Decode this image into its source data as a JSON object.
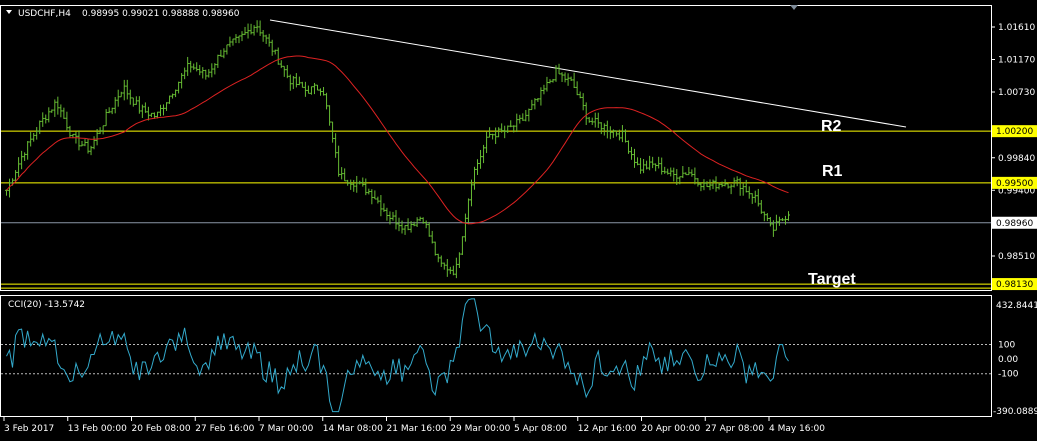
{
  "header": {
    "symbol": "USDCHF,H4",
    "ohlc": "0.98995 0.99021 0.98888 0.98960"
  },
  "indicator": {
    "name": "CCI(20) -13.5742",
    "axis_top_label": "432.8441",
    "axis_bottom_label": "-390.0889",
    "levels": [
      "100",
      "0.00",
      "-100"
    ]
  },
  "annotations": {
    "r2": "R2",
    "r1": "R1",
    "target": "Target"
  },
  "price_axis": {
    "ticks": [
      "1.01610",
      "1.01170",
      "1.00730",
      "0.99840",
      "0.99400",
      "0.98510"
    ],
    "highlighted": [
      "1.00200",
      "0.99500",
      "0.98130"
    ],
    "current": "0.98960"
  },
  "time_axis": {
    "labels": [
      "3 Feb 2017",
      "13 Feb 00:00",
      "20 Feb 08:00",
      "27 Feb 16:00",
      "7 Mar 00:00",
      "14 Mar 08:00",
      "21 Mar 16:00",
      "29 Mar 00:00",
      "5 Apr 08:00",
      "12 Apr 16:00",
      "20 Apr 00:00",
      "27 Apr 08:00",
      "4 May 16:00"
    ]
  },
  "colors": {
    "background": "#000000",
    "bars": "#66bb33",
    "ma": "#dd2222",
    "level": "#ffff00",
    "trendline": "#ffffff",
    "cci": "#33aacc",
    "frame": "#ffffff"
  },
  "chart_data": {
    "type": "line",
    "title": "USDCHF,H4",
    "x_range": [
      "3 Feb 2017",
      "4 May 16:00"
    ],
    "y_range": [
      0.9813,
      1.0161
    ],
    "series": [
      {
        "name": "USDCHF,H4",
        "values": [
          0.994,
          0.999,
          1.003,
          1.006,
          1.001,
          0.9995,
          1.004,
          1.008,
          1.005,
          1.004,
          1.0075,
          1.011,
          1.0095,
          1.013,
          1.0145,
          1.0165,
          1.013,
          1.009,
          1.0075,
          1.008,
          0.996,
          0.995,
          0.9935,
          0.9905,
          0.989,
          0.9905,
          0.984,
          0.983,
          0.996,
          1.0015,
          1.002,
          1.0035,
          1.0065,
          1.01,
          1.0085,
          1.0035,
          1.0025,
          1.0015,
          0.997,
          0.9975,
          0.996,
          0.9965,
          0.9945,
          0.995,
          0.995,
          0.993,
          0.9885,
          0.991
        ]
      }
    ],
    "levels": {
      "R2": 1.002,
      "R1": 0.995,
      "Target": 0.9813,
      "current": 0.9896
    },
    "cci": {
      "name": "CCI(20)",
      "last": -13.5742,
      "ylim": [
        -390.0889,
        432.8441
      ],
      "levels": [
        100,
        0,
        -100
      ]
    }
  }
}
